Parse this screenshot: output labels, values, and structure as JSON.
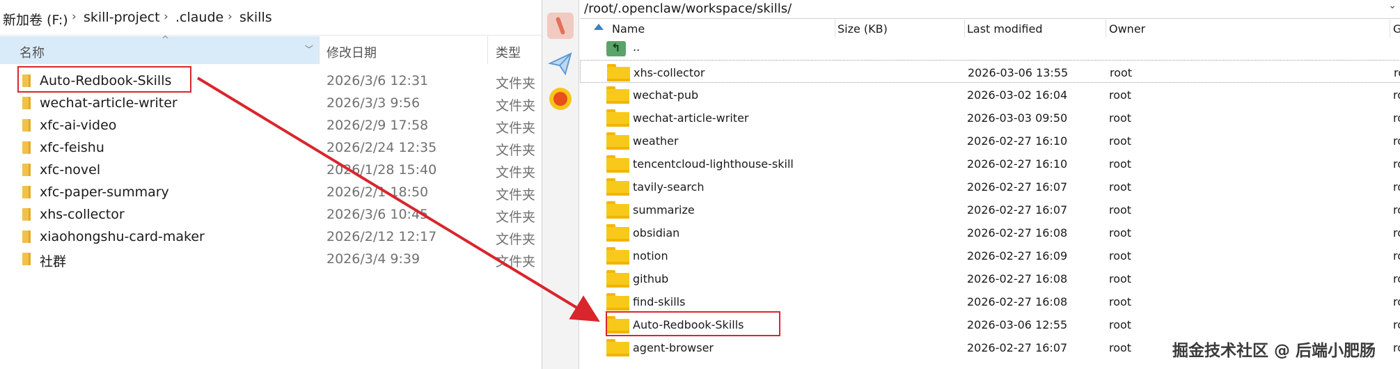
{
  "explorer": {
    "breadcrumb": [
      "新加卷 (F:)",
      "skill-project",
      ".claude",
      "skills"
    ],
    "columns": {
      "name": "名称",
      "date": "修改日期",
      "type": "类型"
    },
    "rows": [
      {
        "name": "Auto-Redbook-Skills",
        "date": "2026/3/6 12:31",
        "type": "文件夹"
      },
      {
        "name": "wechat-article-writer",
        "date": "2026/3/3 9:56",
        "type": "文件夹"
      },
      {
        "name": "xfc-ai-video",
        "date": "2026/2/9 17:58",
        "type": "文件夹"
      },
      {
        "name": "xfc-feishu",
        "date": "2026/2/24 12:35",
        "type": "文件夹"
      },
      {
        "name": "xfc-novel",
        "date": "2026/1/28 15:40",
        "type": "文件夹"
      },
      {
        "name": "xfc-paper-summary",
        "date": "2026/2/1 18:50",
        "type": "文件夹"
      },
      {
        "name": "xhs-collector",
        "date": "2026/3/6 10:45",
        "type": "文件夹"
      },
      {
        "name": "xiaohongshu-card-maker",
        "date": "2026/2/12 12:17",
        "type": "文件夹"
      },
      {
        "name": "社群",
        "date": "2026/3/4 9:39",
        "type": "文件夹"
      }
    ]
  },
  "remote": {
    "path": "/root/.openclaw/workspace/skills/",
    "columns": {
      "name": "Name",
      "size": "Size (KB)",
      "modified": "Last modified",
      "owner": "Owner",
      "group": "Group"
    },
    "parent": "..",
    "rows": [
      {
        "name": "xhs-collector",
        "modified": "2026-03-06 13:55",
        "owner": "root",
        "group": "root"
      },
      {
        "name": "wechat-pub",
        "modified": "2026-03-02 16:04",
        "owner": "root",
        "group": "root"
      },
      {
        "name": "wechat-article-writer",
        "modified": "2026-03-03 09:50",
        "owner": "root",
        "group": "root"
      },
      {
        "name": "weather",
        "modified": "2026-02-27 16:10",
        "owner": "root",
        "group": "root"
      },
      {
        "name": "tencentcloud-lighthouse-skill",
        "modified": "2026-02-27 16:10",
        "owner": "root",
        "group": "root"
      },
      {
        "name": "tavily-search",
        "modified": "2026-02-27 16:07",
        "owner": "root",
        "group": "root"
      },
      {
        "name": "summarize",
        "modified": "2026-02-27 16:07",
        "owner": "root",
        "group": "root"
      },
      {
        "name": "obsidian",
        "modified": "2026-02-27 16:08",
        "owner": "root",
        "group": "root"
      },
      {
        "name": "notion",
        "modified": "2026-02-27 16:09",
        "owner": "root",
        "group": "root"
      },
      {
        "name": "github",
        "modified": "2026-02-27 16:08",
        "owner": "root",
        "group": "root"
      },
      {
        "name": "find-skills",
        "modified": "2026-02-27 16:08",
        "owner": "root",
        "group": "root"
      },
      {
        "name": "Auto-Redbook-Skills",
        "modified": "2026-03-06 12:55",
        "owner": "root",
        "group": "root"
      },
      {
        "name": "agent-browser",
        "modified": "2026-02-27 16:07",
        "owner": "root",
        "group": "root"
      }
    ]
  },
  "watermark": "掘金技术社区 @ 后端小肥肠",
  "colors": {
    "highlight": "#d9252c",
    "folder": "#f8c91a",
    "header_selected": "#d9ebf9"
  }
}
